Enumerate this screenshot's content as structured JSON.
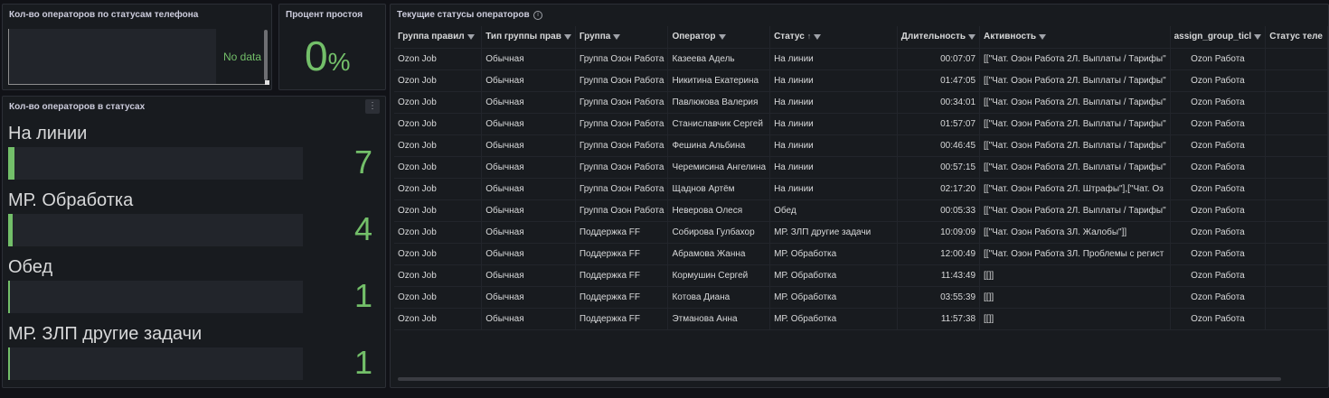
{
  "panel_phone": {
    "title": "Кол-во операторов по статусам телефона",
    "no_data": "No data"
  },
  "panel_idle": {
    "title": "Процент простоя",
    "value": "0",
    "unit": "%"
  },
  "panel_statuses": {
    "title": "Кол-во операторов в статусах",
    "items": [
      {
        "label": "На линии",
        "value": "7",
        "fraction": 0.02
      },
      {
        "label": "МР. Обработка",
        "value": "4",
        "fraction": 0.015
      },
      {
        "label": "Обед",
        "value": "1",
        "fraction": 0.005
      },
      {
        "label": "МР. ЗЛП другие задачи",
        "value": "1",
        "fraction": 0.005
      }
    ]
  },
  "panel_table": {
    "title": "Текущие статусы операторов",
    "columns": [
      "Группа правил",
      "Тип группы прав",
      "Группа",
      "Оператор",
      "Статус",
      "Длительность",
      "Активность",
      "assign_group_ticl",
      "Статус теле"
    ],
    "rows": [
      [
        "Ozon Job",
        "Обычная",
        "Группа Озон Работа",
        "Казеева Адель",
        "На линии",
        "00:07:07",
        "[[\"Чат. Озон Работа 2Л. Выплаты / Тарифы\"",
        "Ozon Работа",
        ""
      ],
      [
        "Ozon Job",
        "Обычная",
        "Группа Озон Работа",
        "Никитина Екатерина",
        "На линии",
        "01:47:05",
        "[[\"Чат. Озон Работа 2Л. Выплаты / Тарифы\"",
        "Ozon Работа",
        ""
      ],
      [
        "Ozon Job",
        "Обычная",
        "Группа Озон Работа",
        "Павлюкова Валерия",
        "На линии",
        "00:34:01",
        "[[\"Чат. Озон Работа 2Л. Выплаты / Тарифы\"",
        "Ozon Работа",
        ""
      ],
      [
        "Ozon Job",
        "Обычная",
        "Группа Озон Работа",
        "Станиславчик Сергей",
        "На линии",
        "01:57:07",
        "[[\"Чат. Озон Работа 2Л. Выплаты / Тарифы\"",
        "Ozon Работа",
        ""
      ],
      [
        "Ozon Job",
        "Обычная",
        "Группа Озон Работа",
        "Фешина Альбина",
        "На линии",
        "00:46:45",
        "[[\"Чат. Озон Работа 2Л. Выплаты / Тарифы\"",
        "Ozon Работа",
        ""
      ],
      [
        "Ozon Job",
        "Обычная",
        "Группа Озон Работа",
        "Черемисина Ангелина",
        "На линии",
        "00:57:15",
        "[[\"Чат. Озон Работа 2Л. Выплаты / Тарифы\"",
        "Ozon Работа",
        ""
      ],
      [
        "Ozon Job",
        "Обычная",
        "Группа Озон Работа",
        "Щаднов Артём",
        "На линии",
        "02:17:20",
        "[[\"Чат. Озон Работа 2Л. Штрафы\"],[\"Чат. Оз",
        "Ozon Работа",
        ""
      ],
      [
        "Ozon Job",
        "Обычная",
        "Группа Озон Работа",
        "Неверова Олеся",
        "Обед",
        "00:05:33",
        "[[\"Чат. Озон Работа 2Л. Выплаты / Тарифы\"",
        "Ozon Работа",
        ""
      ],
      [
        "Ozon Job",
        "Обычная",
        "Поддержка FF",
        "Собирова Гулбахор",
        "МР. ЗЛП другие задачи",
        "10:09:09",
        "[[\"Чат. Озон Работа 3Л. Жалобы\"]]",
        "Ozon Работа",
        ""
      ],
      [
        "Ozon Job",
        "Обычная",
        "Поддержка FF",
        "Абрамова Жанна",
        "МР. Обработка",
        "12:00:49",
        "[[\"Чат. Озон Работа 3Л. Проблемы с регист",
        "Ozon Работа",
        ""
      ],
      [
        "Ozon Job",
        "Обычная",
        "Поддержка FF",
        "Кормушин Сергей",
        "МР. Обработка",
        "11:43:49",
        "[[]]",
        "Ozon Работа",
        ""
      ],
      [
        "Ozon Job",
        "Обычная",
        "Поддержка FF",
        "Котова Диана",
        "МР. Обработка",
        "03:55:39",
        "[[]]",
        "Ozon Работа",
        ""
      ],
      [
        "Ozon Job",
        "Обычная",
        "Поддержка FF",
        "Этманова Анна",
        "МР. Обработка",
        "11:57:38",
        "[[]]",
        "Ozon Работа",
        ""
      ]
    ]
  },
  "colors": {
    "accent": "#73bf69",
    "panel": "#181b1f",
    "background": "#111217"
  },
  "icons": {
    "filter": "filter-icon",
    "sort": "sort-asc-icon",
    "info": "info-icon",
    "menu": "panel-menu-icon"
  }
}
